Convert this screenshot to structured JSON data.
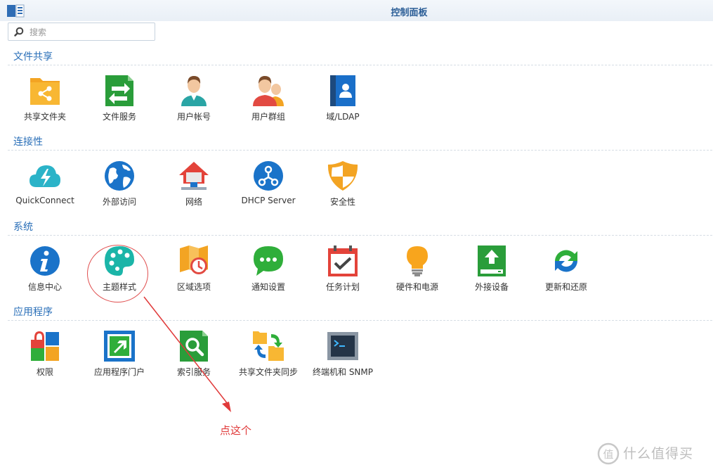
{
  "window": {
    "title": "控制面板"
  },
  "search": {
    "placeholder": "搜索"
  },
  "sections": [
    {
      "title": "文件共享",
      "items": [
        {
          "label": "共享文件夹",
          "icon": "shared-folder-icon"
        },
        {
          "label": "文件服务",
          "icon": "file-services-icon"
        },
        {
          "label": "用户帐号",
          "icon": "user-icon"
        },
        {
          "label": "用户群组",
          "icon": "group-icon"
        },
        {
          "label": "域/LDAP",
          "icon": "domain-ldap-icon"
        }
      ]
    },
    {
      "title": "连接性",
      "items": [
        {
          "label": "QuickConnect",
          "icon": "quickconnect-icon"
        },
        {
          "label": "外部访问",
          "icon": "external-access-icon"
        },
        {
          "label": "网络",
          "icon": "network-icon"
        },
        {
          "label": "DHCP Server",
          "icon": "dhcp-server-icon"
        },
        {
          "label": "安全性",
          "icon": "security-icon"
        }
      ]
    },
    {
      "title": "系统",
      "items": [
        {
          "label": "信息中心",
          "icon": "info-center-icon"
        },
        {
          "label": "主题样式",
          "icon": "theme-palette-icon"
        },
        {
          "label": "区域选项",
          "icon": "regional-options-icon"
        },
        {
          "label": "通知设置",
          "icon": "notification-icon"
        },
        {
          "label": "任务计划",
          "icon": "task-scheduler-icon"
        },
        {
          "label": "硬件和电源",
          "icon": "hardware-power-icon"
        },
        {
          "label": "外接设备",
          "icon": "external-devices-icon"
        },
        {
          "label": "更新和还原",
          "icon": "update-restore-icon"
        }
      ]
    },
    {
      "title": "应用程序",
      "items": [
        {
          "label": "权限",
          "icon": "privileges-icon"
        },
        {
          "label": "应用程序门户",
          "icon": "application-portal-icon"
        },
        {
          "label": "索引服务",
          "icon": "indexing-service-icon"
        },
        {
          "label": "共享文件夹同步",
          "icon": "shared-folder-sync-icon"
        },
        {
          "label": "终端机和 SNMP",
          "icon": "terminal-snmp-icon"
        }
      ]
    }
  ],
  "annotation": {
    "text": "点这个",
    "color": "#e03a3a"
  },
  "watermark": {
    "text": "什么值得买"
  },
  "colors": {
    "accent": "#2a6fb8",
    "title": "#2a5d96"
  }
}
